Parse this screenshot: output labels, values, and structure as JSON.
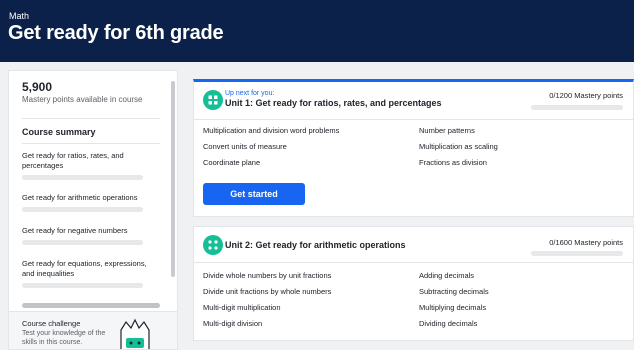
{
  "header": {
    "subject": "Math",
    "title": "Get ready for 6th grade"
  },
  "sidebar": {
    "points_value": "5,900",
    "points_label": "Mastery points available in course",
    "summary_title": "Course summary",
    "units": [
      {
        "label": "Get ready for ratios, rates, and percentages",
        "progress": 0
      },
      {
        "label": "Get ready for arithmetic operations",
        "progress": 0
      },
      {
        "label": "Get ready for negative numbers",
        "progress": 0
      },
      {
        "label": "Get ready for equations, expressions, and inequalities",
        "progress": 0
      }
    ],
    "challenge": {
      "title": "Course challenge",
      "description": "Test your knowledge of the skills in this course."
    }
  },
  "main": {
    "unit1": {
      "up_next": "Up next for you:",
      "title": "Unit 1: Get ready for ratios, rates, and percentages",
      "mastery": "0/1200 Mastery points",
      "mastery_progress": 0,
      "skills": [
        "Multiplication and division word problems",
        "Number patterns",
        "Convert units of measure",
        "Multiplication as scaling",
        "Coordinate plane",
        "Fractions as division"
      ],
      "button": "Get started"
    },
    "unit2": {
      "title": "Unit 2: Get ready for arithmetic operations",
      "mastery": "0/1600 Mastery points",
      "mastery_progress": 0,
      "skills": [
        "Divide whole numbers by unit fractions",
        "Adding decimals",
        "Divide unit fractions by whole numbers",
        "Subtracting decimals",
        "Multi-digit multiplication",
        "Multiplying decimals",
        "Multi-digit division",
        "Dividing decimals"
      ]
    }
  },
  "colors": {
    "header_bg": "#0b2149",
    "accent": "#1865f2",
    "unit_icon": "#14bf96"
  },
  "icons": {
    "unit1": "grid-icon",
    "unit2": "dots-icon",
    "challenge": "trophy-icon"
  }
}
